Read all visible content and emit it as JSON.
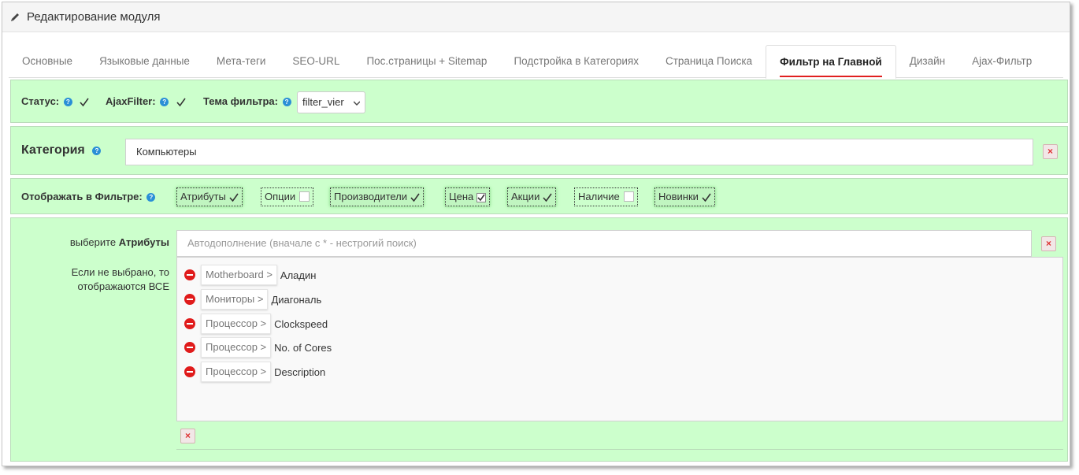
{
  "header": {
    "title": "Редактирование модуля",
    "icon": "pencil-icon"
  },
  "tabs": [
    {
      "label": "Основные"
    },
    {
      "label": "Языковые данные"
    },
    {
      "label": "Мета-теги"
    },
    {
      "label": "SEO-URL"
    },
    {
      "label": "Пос.страницы + Sitemap"
    },
    {
      "label": "Подстройка в Категориях"
    },
    {
      "label": "Страница Поиска"
    },
    {
      "label": "Фильтр на Главной",
      "active": true
    },
    {
      "label": "Дизайн"
    },
    {
      "label": "Ajax-Фильтр"
    }
  ],
  "settings": {
    "status_label": "Статус:",
    "ajaxfilter_label": "AjaxFilter:",
    "theme_label": "Тема фильтра:",
    "theme_value": "filter_vier",
    "help_glyph": "?"
  },
  "category": {
    "label": "Категория",
    "value": "Компьютеры",
    "remove": "×"
  },
  "display": {
    "label": "Отображать в Фильтре:",
    "options": [
      {
        "label": "Атрибуты",
        "checked": true
      },
      {
        "label": "Опции",
        "checked": false
      },
      {
        "label": "Производители",
        "checked": true
      },
      {
        "label": "Цена",
        "checked": true
      },
      {
        "label": "Акции",
        "checked": true
      },
      {
        "label": "Наличие",
        "checked": false
      },
      {
        "label": "Новинки",
        "checked": true
      }
    ]
  },
  "attributes": {
    "label_prefix": "выберите",
    "label_bold": "Атрибуты",
    "placeholder": "Автодополнение (вначале с * - нестрогий поиск)",
    "hint": "Если не выбрано, то отображаются ВСЕ",
    "remove": "×",
    "items": [
      {
        "group": "Motherboard >",
        "name": "Аладин"
      },
      {
        "group": "Мониторы >",
        "name": "Диагональ"
      },
      {
        "group": "Процессор >",
        "name": "Clockspeed"
      },
      {
        "group": "Процессор >",
        "name": "No. of Cores"
      },
      {
        "group": "Процессор >",
        "name": "Description"
      }
    ]
  },
  "colors": {
    "accent_red": "#e02020",
    "row_green": "#ccffcc",
    "help_blue": "#2a8fd6"
  }
}
